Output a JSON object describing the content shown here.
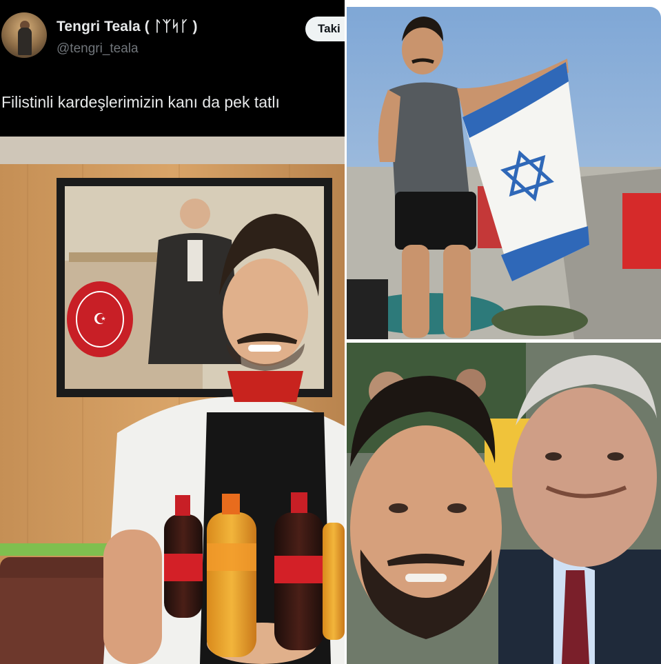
{
  "tweet": {
    "display_name": "Tengri Teala ( ᛚᛉᛋᚴ )",
    "handle": "@tengri_teala",
    "follow_label": "Taki",
    "text": "Filistinli kardeşlerimizin kanı da pek tatlı"
  },
  "icons": {
    "avatar": "profile-avatar"
  },
  "colors": {
    "tweet_background": "#000000",
    "name_text": "#e7e9ea",
    "handle_text": "#71767b",
    "follow_button_bg": "#eff3f4"
  }
}
